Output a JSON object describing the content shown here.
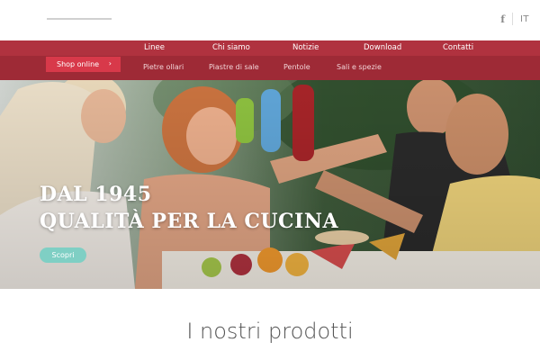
{
  "header": {
    "social_icon": "facebook-icon",
    "social_label": "f",
    "language": "IT"
  },
  "main_nav": {
    "items": [
      {
        "label": "Linee"
      },
      {
        "label": "Chi siamo"
      },
      {
        "label": "Notizie"
      },
      {
        "label": "Download"
      },
      {
        "label": "Contatti"
      }
    ]
  },
  "sub_nav": {
    "shop_label": "Shop online",
    "shop_arrow": "›",
    "items": [
      {
        "label": "Pietre ollari"
      },
      {
        "label": "Piastre di sale"
      },
      {
        "label": "Pentole"
      },
      {
        "label": "Sali e spezie"
      }
    ]
  },
  "hero": {
    "title_line1": "DAL 1945",
    "title_line2": "QUALITÀ PER LA CUCINA",
    "cta_label": "Scopri"
  },
  "products": {
    "heading": "I nostri prodotti"
  },
  "colors": {
    "main_nav_bg": "#b0323f",
    "sub_nav_bg": "#9e2a36",
    "shop_button": "#d8394a",
    "cta_button": "#7fcfc4"
  }
}
